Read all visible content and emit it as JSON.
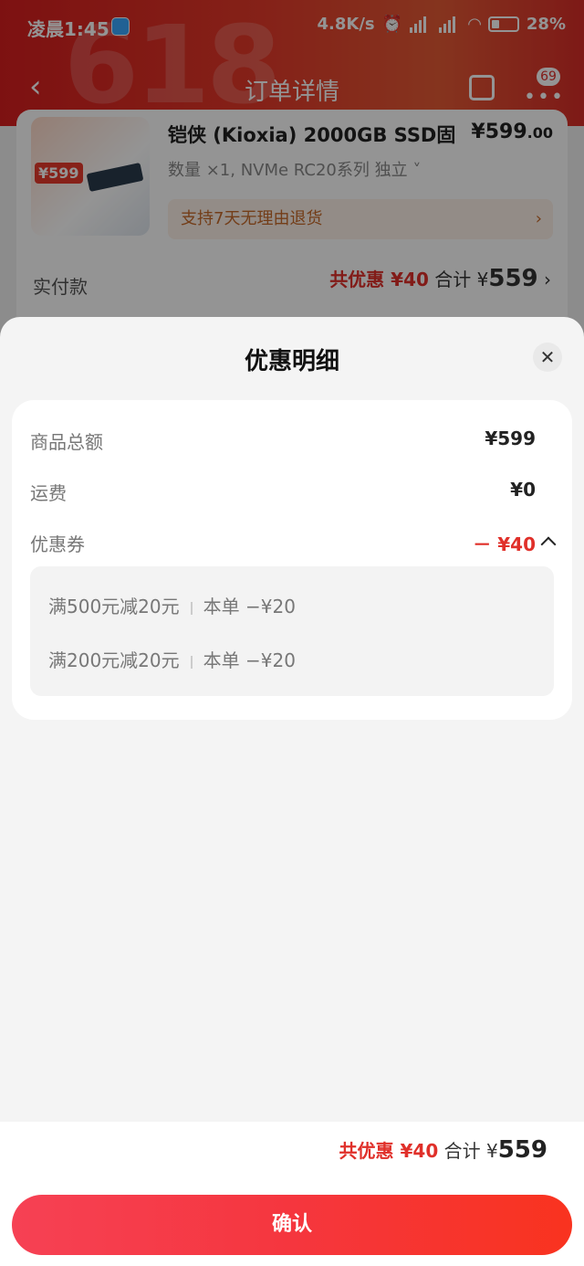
{
  "status": {
    "time": "凌晨1:45",
    "net_speed": "4.8K/s",
    "battery": "28%"
  },
  "nav": {
    "title": "订单详情",
    "badge": "69",
    "banner_deco": "618"
  },
  "order": {
    "product_name": "铠侠 (Kioxia) 2000GB SSD固",
    "price_main": "¥599",
    "price_decimal": ".00",
    "spec": "数量 ×1, NVMe  RC20系列  独立 ˅",
    "thumb_tag": "¥599",
    "return_policy": "支持7天无理由退货",
    "pay_label": "实付款",
    "pay_discount": "共优惠 ¥40",
    "pay_total_label": " 合计 ¥",
    "pay_total": "559"
  },
  "sheet": {
    "title": "优惠明细",
    "rows": [
      {
        "label": "商品总额",
        "value": "¥599"
      },
      {
        "label": "运费",
        "value": "¥0"
      },
      {
        "label": "优惠券",
        "value": "－ ¥40"
      }
    ],
    "coupons": [
      {
        "name": "满500元减20元",
        "amount": "本单 −¥20"
      },
      {
        "name": "满200元减20元",
        "amount": "本单 −¥20"
      }
    ],
    "summary_discount": "共优惠 ¥40",
    "summary_total_label": " 合计 ¥",
    "summary_total": "559",
    "confirm_label": "确认"
  },
  "colors": {
    "accent_red": "#e0302a",
    "confirm_start": "#f64154",
    "confirm_end": "#f9331f"
  }
}
